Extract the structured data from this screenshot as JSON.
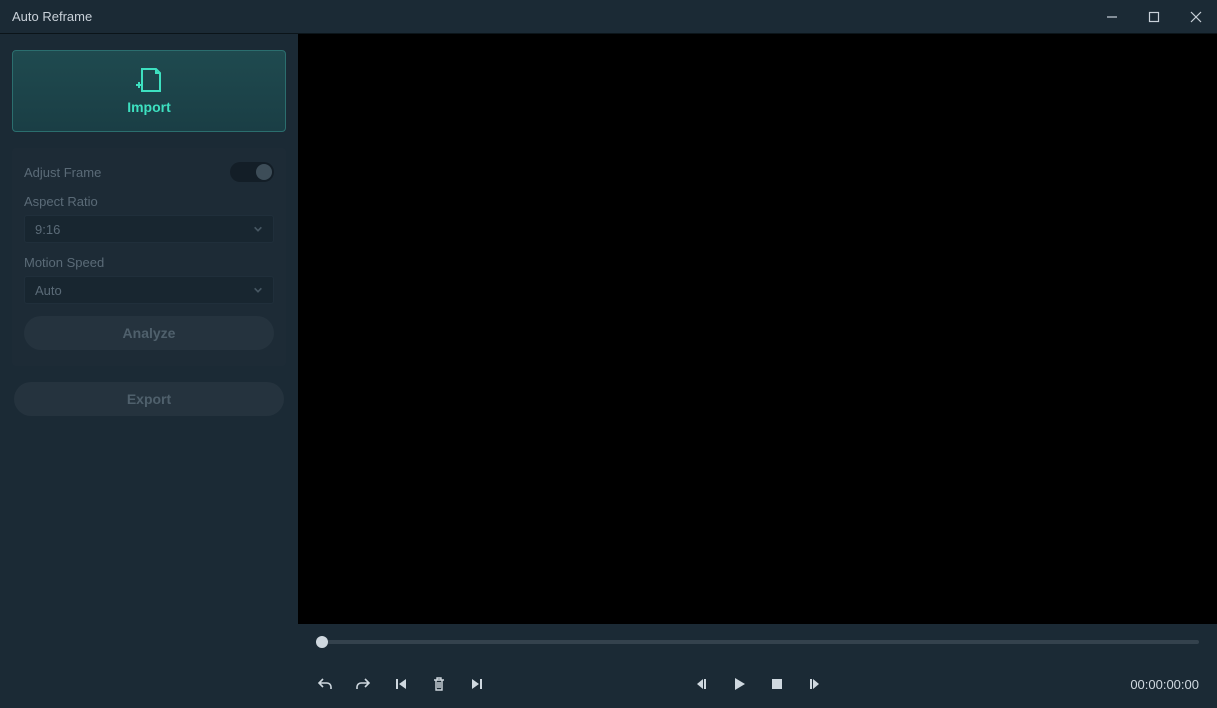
{
  "titlebar": {
    "title": "Auto Reframe"
  },
  "sidebar": {
    "import_label": "Import",
    "adjust_frame_label": "Adjust Frame",
    "adjust_frame_on": false,
    "aspect_ratio_label": "Aspect Ratio",
    "aspect_ratio_value": "9:16",
    "motion_speed_label": "Motion Speed",
    "motion_speed_value": "Auto",
    "analyze_label": "Analyze",
    "export_label": "Export"
  },
  "player": {
    "timecode": "00:00:00:00"
  }
}
